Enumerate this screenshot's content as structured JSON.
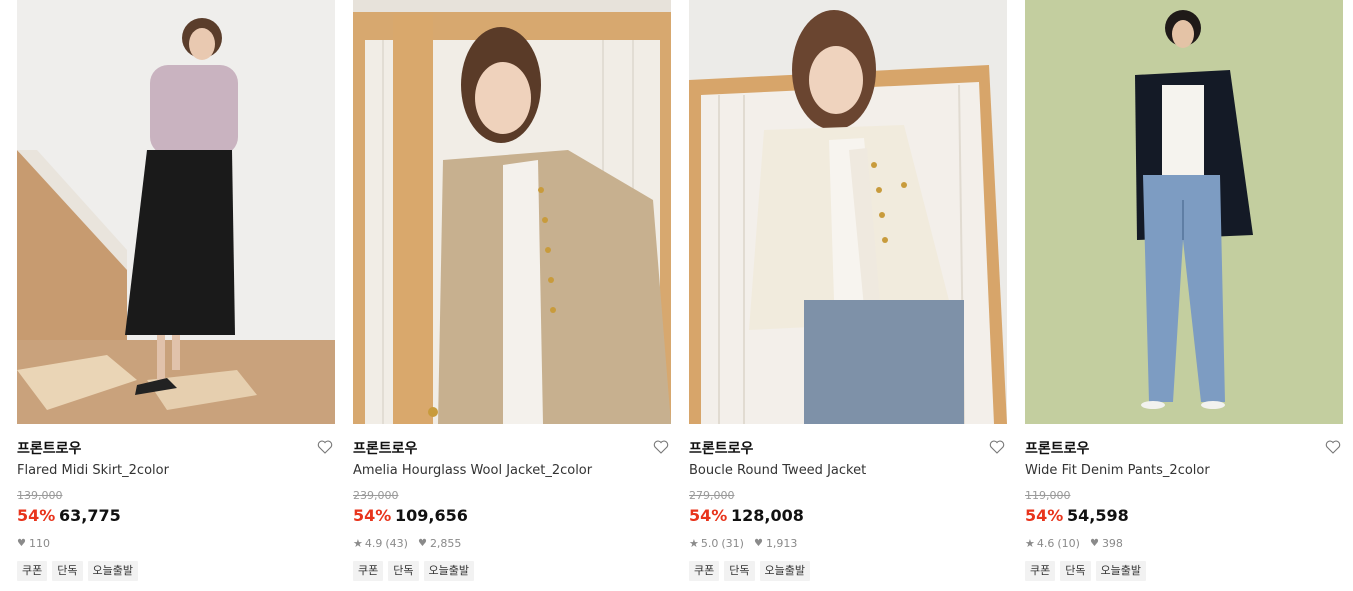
{
  "products": [
    {
      "brand": "프론트로우",
      "name": "Flared Midi Skirt_2color",
      "original_price": "139,000",
      "discount": "54%",
      "price": "63,775",
      "rating": "",
      "review_count": "",
      "likes": "110",
      "tags": [
        "쿠폰",
        "단독",
        "오늘출발"
      ]
    },
    {
      "brand": "프론트로우",
      "name": "Amelia Hourglass Wool Jacket_2color",
      "original_price": "239,000",
      "discount": "54%",
      "price": "109,656",
      "rating": "4.9",
      "review_count": "(43)",
      "likes": "2,855",
      "tags": [
        "쿠폰",
        "단독",
        "오늘출발"
      ]
    },
    {
      "brand": "프론트로우",
      "name": "Boucle Round Tweed Jacket",
      "original_price": "279,000",
      "discount": "54%",
      "price": "128,008",
      "rating": "5.0",
      "review_count": "(31)",
      "likes": "1,913",
      "tags": [
        "쿠폰",
        "단독",
        "오늘출발"
      ]
    },
    {
      "brand": "프론트로우",
      "name": "Wide Fit Denim Pants_2color",
      "original_price": "119,000",
      "discount": "54%",
      "price": "54,598",
      "rating": "4.6",
      "review_count": "(10)",
      "likes": "398",
      "tags": [
        "쿠폰",
        "단독",
        "오늘출발"
      ]
    }
  ],
  "colors": {
    "discount": "#e8341c",
    "muted": "#8a8a8a",
    "tag_bg": "#f2f2f2"
  },
  "icons": {
    "like": "heart-outline-icon",
    "rating": "star-icon",
    "likes": "heart-filled-icon"
  }
}
